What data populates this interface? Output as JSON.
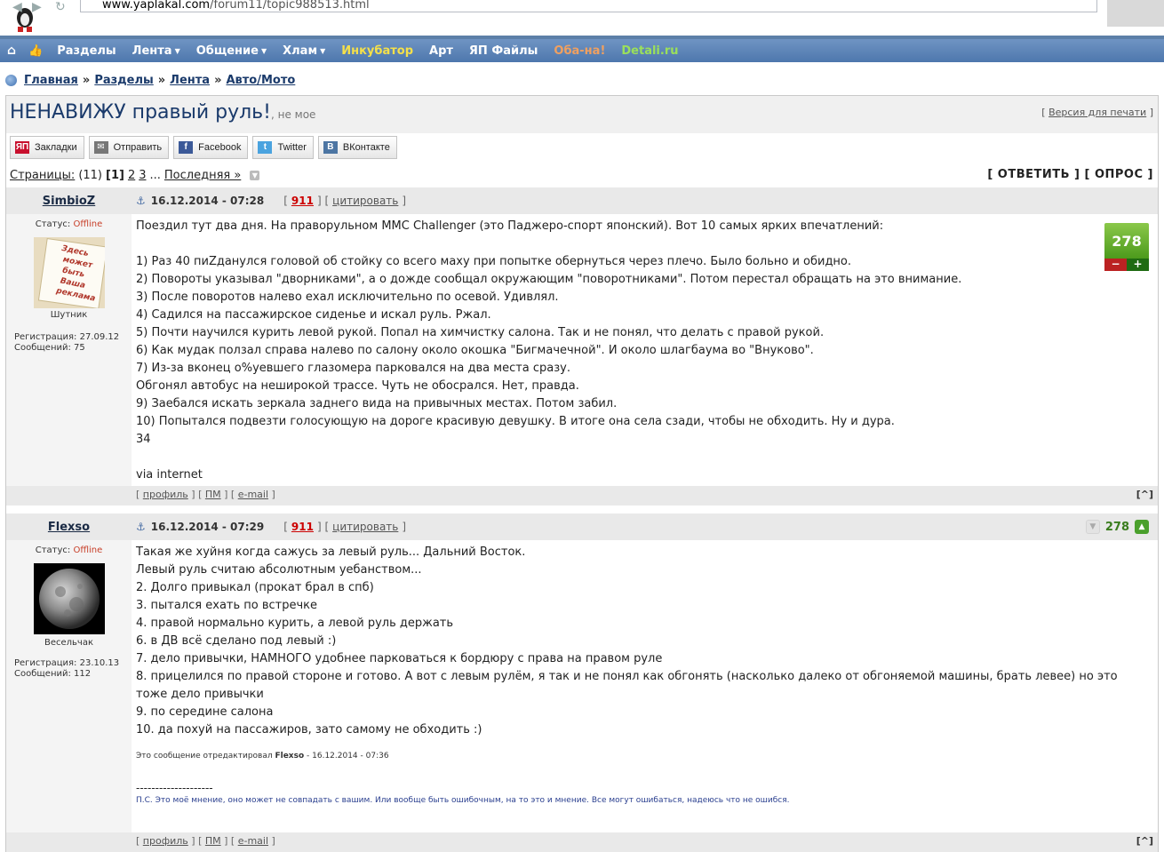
{
  "browser": {
    "url_host": "www.yaplakal.com",
    "url_path": "/forum11/topic988513.html"
  },
  "nav": {
    "items": [
      {
        "label": "Разделы",
        "caret": false,
        "color": "#ffffff"
      },
      {
        "label": "Лента",
        "caret": true,
        "color": "#ffffff"
      },
      {
        "label": "Общение",
        "caret": true,
        "color": "#ffffff"
      },
      {
        "label": "Хлам",
        "caret": true,
        "color": "#ffffff"
      },
      {
        "label": "Инкубатор",
        "caret": false,
        "color": "#f5e04a"
      },
      {
        "label": "Арт",
        "caret": false,
        "color": "#ffffff"
      },
      {
        "label": "ЯП Файлы",
        "caret": false,
        "color": "#ffffff"
      },
      {
        "label": "Оба-на!",
        "caret": false,
        "color": "#f0a060"
      },
      {
        "label": "Detali.ru",
        "caret": false,
        "color": "#9be05a"
      }
    ]
  },
  "breadcrumbs": {
    "items": [
      "Главная",
      "Разделы",
      "Лента",
      "Авто/Мото"
    ],
    "separator": "»"
  },
  "topic": {
    "title": "НЕНАВИЖУ правый руль!",
    "subtitle": ", не мое",
    "print_label": "Версия для печати"
  },
  "share": [
    {
      "label": "Закладки",
      "icon": "yap-icon",
      "icon_text": "ЯП",
      "color": "#c8102e"
    },
    {
      "label": "Отправить",
      "icon": "envelope-icon",
      "icon_text": "✉",
      "color": "#777777"
    },
    {
      "label": "Facebook",
      "icon": "facebook-icon",
      "icon_text": "f",
      "color": "#3b5998"
    },
    {
      "label": "Twitter",
      "icon": "twitter-icon",
      "icon_text": "t",
      "color": "#4aa3df"
    },
    {
      "label": "ВКонтакте",
      "icon": "vk-icon",
      "icon_text": "B",
      "color": "#4c75a3"
    }
  ],
  "pagination": {
    "label": "Страницы:",
    "total": "(11)",
    "current": "[1]",
    "pages": [
      "2",
      "3"
    ],
    "ellipsis": "...",
    "last": "Последняя »"
  },
  "actions": "[ ОТВЕТИТЬ ] [ ОПРОС ]",
  "posts": [
    {
      "author": "SimbioZ",
      "date": "16.12.2014 - 07:28",
      "number": "911",
      "quote": "цитировать",
      "status_label": "Статус:",
      "status": "Offline",
      "rank": "Шутник",
      "reg": "Регистрация: 27.09.12",
      "msgs": "Сообщений: 75",
      "rating": "278",
      "lines": [
        "Поездил тут два дня. На праворульном MMC Challenger (это Паджеро-спорт японский). Вот 10 самых ярких впечатлений:",
        "",
        "1) Раз 40 пиZданулся головой об стойку со всего маху при попытке обернуться через плечо. Было больно и обидно.",
        "2) Повороты указывал \"дворниками\", а о дожде сообщал окружающим \"поворотниками\". Потом перестал обращать на это внимание.",
        "3) После поворотов налево ехал исключительно по осевой. Удивлял.",
        "4) Садился на пассажирское сиденье и искал руль. Ржал.",
        "5) Почти научился курить левой рукой. Попал на химчистку салона. Так и не понял, что делать с правой рукой.",
        "6) Как мудак ползал справа налево по салону около окошка \"Бигмачечной\". И около шлагбаума во \"Внуково\".",
        "7) Из-за вконец о%уевшего глазомера парковался на два места сразу.",
        "Обгонял автобус на неширокой трассе. Чуть не обосрался. Нет, правда.",
        "9) Заебался искать зеркала заднего вида на привычных местах. Потом забил.",
        "10) Попытался подвезти голосующую на дороге красивую девушку. В итоге она села сзади, чтобы не обходить. Ну и дура.",
        "34",
        "",
        "via internet"
      ]
    },
    {
      "author": "Flexso",
      "date": "16.12.2014 - 07:29",
      "number": "911",
      "quote": "цитировать",
      "status_label": "Статус:",
      "status": "Offline",
      "rank": "Весельчак",
      "reg": "Регистрация: 23.10.13",
      "msgs": "Сообщений: 112",
      "rating": "278",
      "lines": [
        "Такая же хуйня когда сажусь за левый руль... Дальний Восток.",
        "Левый руль считаю абсолютным уебанством...",
        "2. Долго привыкал (прокат брал в спб)",
        "3. пытался ехать по встречке",
        "4. правой нормально курить, а левой руль держать",
        "6. в ДВ всё сделано под левый :)",
        "7. дело привычки, НАМНОГО удобнее парковаться к бордюру с права на правом руле",
        "8. прицелился по правой стороне и готово. А вот с левым рулём, я так и не понял как обгонять (насколько далеко от обгоняемой машины, брать левее) но это",
        "тоже дело привычки",
        "9. по середине салона",
        "10. да похуй на пассажиров, зато самому не обходить :)"
      ],
      "edited_prefix": "Это сообщение отредактировал ",
      "edited_by": "Flexso",
      "edited_suffix": " - 16.12.2014 - 07:36",
      "sig_dashes": "--------------------",
      "signature": "П.С. Это моё мнение, оно может не совпадать с вашим. Или вообще быть ошибочным, на то это и мнение. Все могут ошибаться, надеюсь что не ошибся."
    }
  ],
  "footer_links": {
    "profile": "профиль",
    "pm": "ПМ",
    "email": "e-mail",
    "up": "[^]"
  }
}
